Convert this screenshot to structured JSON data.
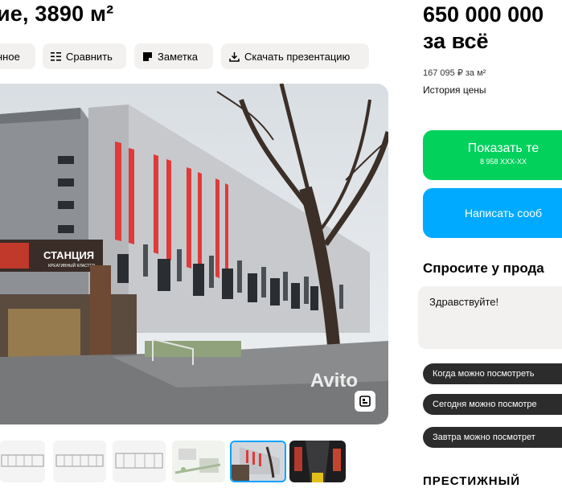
{
  "listing": {
    "title": "ие, 3890 м²"
  },
  "actions": [
    {
      "label": "нное",
      "icon": "heart-icon"
    },
    {
      "label": "Сравнить",
      "icon": "compare-icon"
    },
    {
      "label": "Заметка",
      "icon": "note-icon"
    },
    {
      "label": "Скачать презентацию",
      "icon": "download-icon"
    }
  ],
  "photo": {
    "sign_text": "СТАНЦИЯ",
    "sign_subtext": "КРЕАТИВНЫЙ КЛАСТЕР",
    "watermark": "Avito",
    "gallery_icon": "gallery-icon"
  },
  "thumbnails": [
    {
      "kind": "floor-plan"
    },
    {
      "kind": "floor-plan"
    },
    {
      "kind": "floor-plan"
    },
    {
      "kind": "site-plan"
    },
    {
      "kind": "building-photo",
      "active": true
    },
    {
      "kind": "interior-photo"
    }
  ],
  "price": {
    "line1": "650 000 000",
    "line2": "за всё",
    "per_m2": "167 095 ₽ за м²",
    "history_link": "История цены"
  },
  "contact": {
    "phone_label": "Показать те",
    "phone_number": "8 958 XXX-XX",
    "message_label": "Написать сооб"
  },
  "ask": {
    "title": "Спросите у прода",
    "message": "Здравствуйте!",
    "chips": [
      "Когда можно посмотреть",
      "Сегодня можно посмотре",
      "Завтра можно посмотрет"
    ]
  },
  "cut_heading": "ПРЕСТИЖНЫЙ",
  "colors": {
    "green": "#02d15c",
    "blue": "#00aaff",
    "chip": "#2c2c2c",
    "button_bg": "#f2f1f0"
  }
}
